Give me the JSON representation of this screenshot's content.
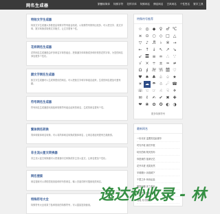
{
  "header": {
    "logo": "网名生成器",
    "nav": [
      "繁體转简体",
      "特殊字符",
      "花样字体",
      "特殊网名",
      "情侣网名",
      "古风网名",
      "个性签名",
      "繁字工具"
    ]
  },
  "main": {
    "cards": [
      {
        "title": "特效文字生成器",
        "desc": "特效文字生成器大多数是由特殊字符号组合而成，以特殊符号修饰比较多，可以把汉字、英文字母、数字转换成特殊文字格式，让文字更有个性。"
      },
      {
        "title": "花样网名生成器",
        "desc": "花样网名生成器是由许多网名字体的组合，把普通字体转换成多种好看的花样字体，为您的网名添加更多个性化。"
      },
      {
        "title": "颜文字网名生成器",
        "desc": "颜文字生成器可以生成带表情的网名，可以把颜文字和字体组合起来，生成的网名更加可爱有趣。"
      },
      {
        "title": "符号网名生成器",
        "desc": "符号网名生成器是利用各种特殊符号组合起来的网名，生成的网名更有个性。"
      },
      {
        "title": "繁体网名转换",
        "desc": "简体转繁体网名转换，可以将简体网名转换成繁体网名，让网名看起来更有古典美感。"
      },
      {
        "title": "非主流火星文转换器",
        "desc": "非主流火星文转换器可以把普通中文转换成非主流火星文，让网名更加个性化。"
      },
      {
        "title": "网名搜索",
        "desc": "网名搜索可以帮助您找到各种好听的网名，输入关键词即可搜索相关网名。"
      },
      {
        "title": "特殊符号大全",
        "desc": "特殊符号大全收录了各种常用的特殊符号，可以直接复制使用。"
      }
    ]
  },
  "sidebar": {
    "symbols_title": "特殊符号推荐",
    "symbols": [
      "☆",
      "◎",
      "◆",
      "♀",
      "♂",
      "℃",
      "¤",
      "⊙",
      "○",
      "◇",
      "□",
      "△",
      "▽",
      "♪",
      "♬",
      "♭",
      "※",
      "→",
      "←",
      "↑",
      "↓",
      "↖",
      "↗",
      "↘",
      "↙",
      "〓",
      "≡",
      "∞",
      "∴",
      "∵",
      "√",
      "×",
      "÷",
      "±",
      "≈",
      "≠",
      "Ω",
      "∮",
      "卍",
      "卐",
      "囍",
      "♡",
      "♥",
      "♠",
      "♣",
      "♧",
      "♤",
      "★",
      "☀",
      "☁",
      "☂",
      "☃",
      "☄",
      "☎",
      "☏",
      "☜",
      "☞",
      "☝",
      "☟",
      "✈",
      "✉",
      "✌",
      "✍",
      "✔",
      "✖",
      "✚",
      "❤",
      "❀",
      "✿",
      "✪",
      "◐",
      "◑"
    ],
    "highlight_symbol": "☁",
    "more_label": "更多特殊符号",
    "latest_title": "最新网名",
    "latest": [
      "一世长安 温柔的如此繁华",
      "时光不老 我们不散",
      "晴天的雨 阴天的你",
      "你是我的 独家记忆",
      "花开半夏 浅笑安然",
      "半城烟沙 兵临城下",
      "千里之外 有你足矣",
      "微笑向暖 安之若素",
      "深情不及久伴",
      "浅唱 月光倾城"
    ]
  },
  "watermark": {
    "text": "逸达秒收录 - 林"
  }
}
